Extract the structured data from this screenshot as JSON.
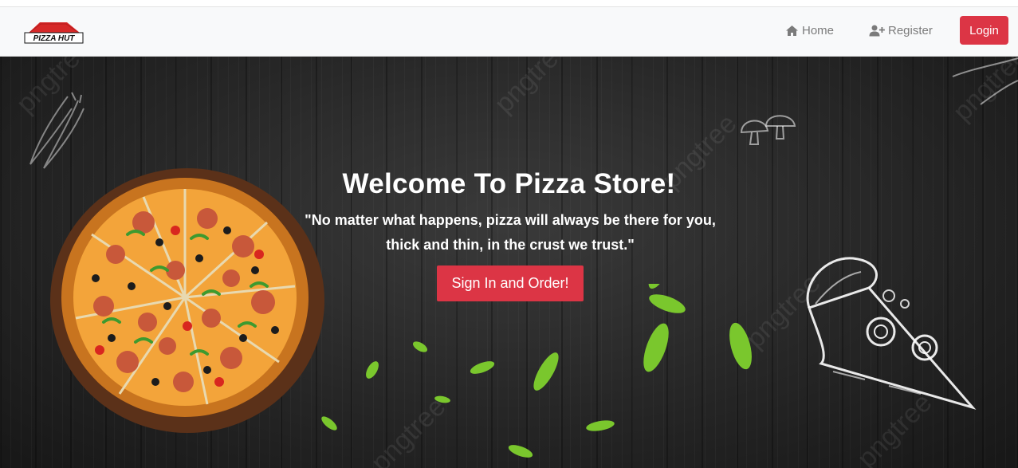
{
  "navbar": {
    "logo_text": "PIZZA HUT",
    "home_label": "Home",
    "register_label": "Register",
    "login_label": "Login"
  },
  "hero": {
    "title": "Welcome To Pizza Store!",
    "quote": "\"No matter what happens, pizza will always be there for you, thick and thin, in the crust we trust.\"",
    "cta_label": "Sign In and Order!",
    "watermark": "pngtree"
  },
  "icons": {
    "home": "home-icon",
    "register": "user-plus-icon"
  },
  "colors": {
    "accent": "#dc3545",
    "navbar_bg": "#f8f9fa",
    "hero_bg": "#262626"
  }
}
